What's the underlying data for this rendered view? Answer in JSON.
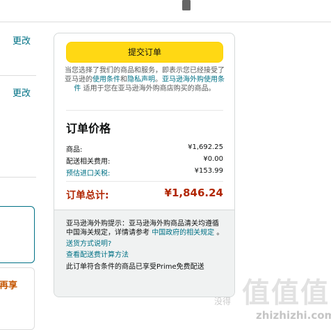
{
  "header": {
    "lock_icon": "lock-icon"
  },
  "left": {
    "change_label_1": "更改",
    "change_label_2": "更改",
    "cut_text": "再享"
  },
  "panel": {
    "submit_label": "提交订单",
    "agreement": {
      "part1": "当您选择了我们的商品和服务，即表示您已经接受了亚马逊的",
      "link1": "使用条件",
      "part2": "和",
      "link2": "隐私声明",
      "part3": "。",
      "link3": "亚马逊海外购使用条件",
      "part4": " 适用于您在亚马逊海外购商店购买的商品。"
    },
    "price_title": "订单价格",
    "rows": [
      {
        "label": "商品:",
        "value": "¥1,692.25",
        "link": false
      },
      {
        "label": "配送相关费用:",
        "value": "¥0.00",
        "link": false
      },
      {
        "label": "预估进口关税:",
        "value": "¥153.99",
        "link": true
      }
    ],
    "total_label": "订单总计:",
    "total_value": "¥1,846.24",
    "footer": {
      "notice_part1": "亚马逊海外购提示：亚马逊海外购商品清关均遵循中国海关规定，详情请参考 ",
      "notice_link": "中国政府的相关规定",
      "notice_part2": " 。",
      "link_shipping": "送货方式说明?",
      "link_fee": "查看配送费计算方法",
      "prime_text": "此订单符合条件的商品已享受Prime免费配送"
    }
  },
  "watermark": {
    "glyphs": "值值值",
    "sub": "没得",
    "url": "zhizhizhi.com"
  },
  "colors": {
    "button_yellow": "#ffd814",
    "link_teal": "#007185",
    "price_red": "#b12704"
  }
}
